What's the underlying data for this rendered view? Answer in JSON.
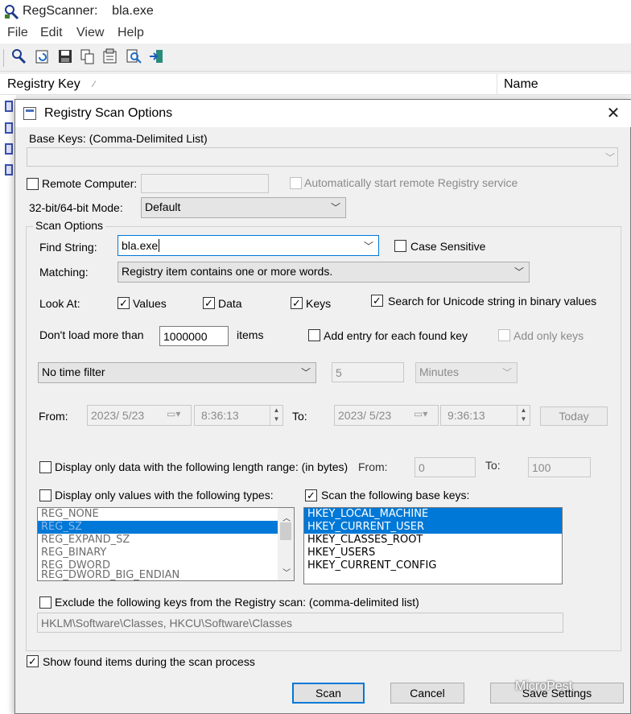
{
  "app": {
    "title": "RegScanner:    bla.exe",
    "menu": [
      "File",
      "Edit",
      "View",
      "Help"
    ],
    "toolbar_icons": [
      "scan-icon",
      "refresh-icon",
      "save-icon",
      "copy-icon",
      "properties-icon",
      "find-icon",
      "exit-icon"
    ],
    "columns": {
      "registry_key": "Registry Key",
      "sort_indicator": "⁄",
      "name": "Name"
    }
  },
  "dialog": {
    "title": "Registry Scan Options",
    "close_glyph": "✕",
    "base_keys_label": "Base Keys:  (Comma-Delimited List)",
    "base_keys_value": "",
    "remote_computer_label": "Remote Computer:",
    "remote_computer_value": "",
    "auto_start_label": "Automatically start remote Registry service",
    "mode_label": "32-bit/64-bit Mode:",
    "mode_value": "Default",
    "scan_options_label": "Scan Options",
    "find_string_label": "Find String:",
    "find_string_value": "bla.exe",
    "case_sensitive_label": "Case Sensitive",
    "matching_label": "Matching:",
    "matching_value": "Registry item contains one or more words.",
    "look_at_label": "Look At:",
    "values_label": "Values",
    "data_label": "Data",
    "keys_label": "Keys",
    "unicode_label": "Search for Unicode string in binary values",
    "dont_load_label": "Don't load more than",
    "max_items_value": "1000000",
    "items_label": "items",
    "add_entry_label": "Add entry for each found key",
    "add_only_keys_label": "Add only keys",
    "time_filter_value": "No time filter",
    "time_amount_value": "5",
    "time_unit_value": "Minutes",
    "from_label": "From:",
    "from_date": "2023/  5/23",
    "from_time": "8:36:13",
    "to_label": "To:",
    "to_date": "2023/  5/23",
    "to_time": "9:36:13",
    "today_label": "Today",
    "length_range_label": "Display only data with the following length range: (in bytes)",
    "length_from_label": "From:",
    "length_from_value": "0",
    "length_to_label": "To:",
    "length_to_value": "100",
    "value_types_label": "Display only values with the following types:",
    "value_types": [
      "REG_NONE",
      "REG_SZ",
      "REG_EXPAND_SZ",
      "REG_BINARY",
      "REG_DWORD",
      "REG_DWORD_BIG_ENDIAN"
    ],
    "scan_base_keys_label": "Scan the following base keys:",
    "base_key_options": [
      "HKEY_LOCAL_MACHINE",
      "HKEY_CURRENT_USER",
      "HKEY_CLASSES_ROOT",
      "HKEY_USERS",
      "HKEY_CURRENT_CONFIG"
    ],
    "exclude_label": "Exclude the following keys from the Registry scan: (comma-delimited list)",
    "exclude_value": "HKLM\\Software\\Classes, HKCU\\Software\\Classes",
    "show_found_label": "Show found items during the scan process",
    "scan_button": "Scan",
    "cancel_button": "Cancel",
    "save_settings_button": "Save Settings",
    "check_glyph": "✓"
  },
  "watermark": "MicroPest",
  "colors": {
    "selection": "#0078d7",
    "default_button_border": "#0078d7",
    "dialog_bg": "#f0f0f0"
  }
}
